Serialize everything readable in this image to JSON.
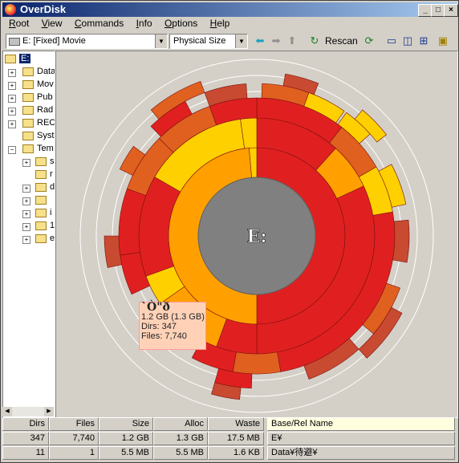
{
  "window": {
    "title": "OverDisk"
  },
  "menu": [
    "Root",
    "View",
    "Commands",
    "Info",
    "Options",
    "Help"
  ],
  "toolbar": {
    "drive": "E: [Fixed] Movie",
    "size_mode": "Physical Size",
    "rescan": "Rescan"
  },
  "tree": {
    "root": "E:",
    "items": [
      {
        "label": "Data",
        "expanded": false
      },
      {
        "label": "Mov",
        "expanded": false
      },
      {
        "label": "Pub",
        "expanded": false
      },
      {
        "label": "Rad",
        "expanded": false
      },
      {
        "label": "REC",
        "expanded": false
      },
      {
        "label": "Syst",
        "expanded": null
      },
      {
        "label": "Tem",
        "expanded": true
      }
    ],
    "subitems": [
      "s",
      "r",
      "d",
      "",
      "i",
      "1",
      "e"
    ]
  },
  "chart": {
    "center_label": "E:"
  },
  "tooltip": {
    "title": "`Ò\"ð",
    "size": "1.2 GB (1.3 GB)",
    "dirs": "Dirs: 347",
    "files": "Files: 7,740"
  },
  "table": {
    "headers": [
      "Dirs",
      "Files",
      "Size",
      "Alloc",
      "Waste",
      "Base/Rel Name"
    ],
    "rows": [
      [
        "347",
        "7,740",
        "1.2 GB",
        "1.3 GB",
        "17.5 MB",
        "E¥"
      ],
      [
        "11",
        "1",
        "5.5 MB",
        "5.5 MB",
        "1.6 KB",
        "Data¥待避¥"
      ]
    ]
  },
  "colors": {
    "title_active": "#0a246a",
    "center_disk": "#808080"
  }
}
